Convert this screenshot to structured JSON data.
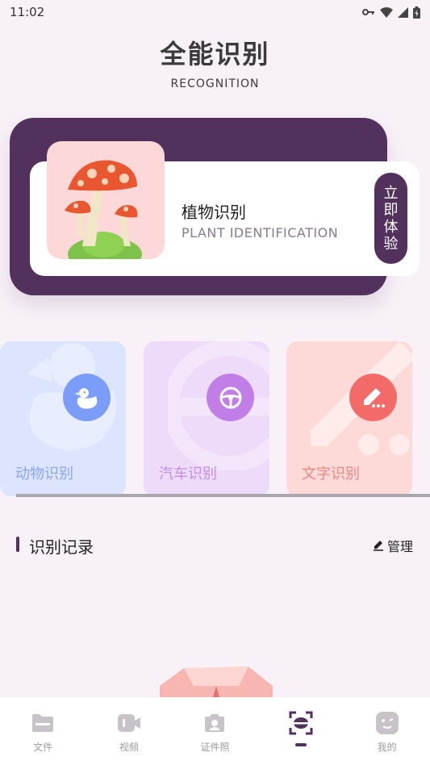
{
  "status": {
    "time": "11:02"
  },
  "hero": {
    "title": "全能识别",
    "subtitle": "RECOGNITION"
  },
  "plant": {
    "name": "植物识别",
    "name_en": "PLANT IDENTIFICATION",
    "try_chars": [
      "立",
      "即",
      "体",
      "验"
    ]
  },
  "features": [
    {
      "label": "动物识别",
      "icon": "duck-icon",
      "color": "#7c9cf9"
    },
    {
      "label": "汽车识别",
      "icon": "steering-wheel-icon",
      "color": "#c07ee6"
    },
    {
      "label": "文字识别",
      "icon": "pen-icon",
      "color": "#f36b68"
    }
  ],
  "records": {
    "title": "识别记录",
    "manage": "管理"
  },
  "tabs": [
    {
      "label": "文件",
      "icon": "folder-icon"
    },
    {
      "label": "视频",
      "icon": "video-icon"
    },
    {
      "label": "证件照",
      "icon": "camera-icon"
    },
    {
      "label": "",
      "icon": "scan-icon",
      "active": true
    },
    {
      "label": "我的",
      "icon": "face-icon"
    }
  ],
  "colors": {
    "accent": "#52315c",
    "background": "#f8f1f7"
  }
}
